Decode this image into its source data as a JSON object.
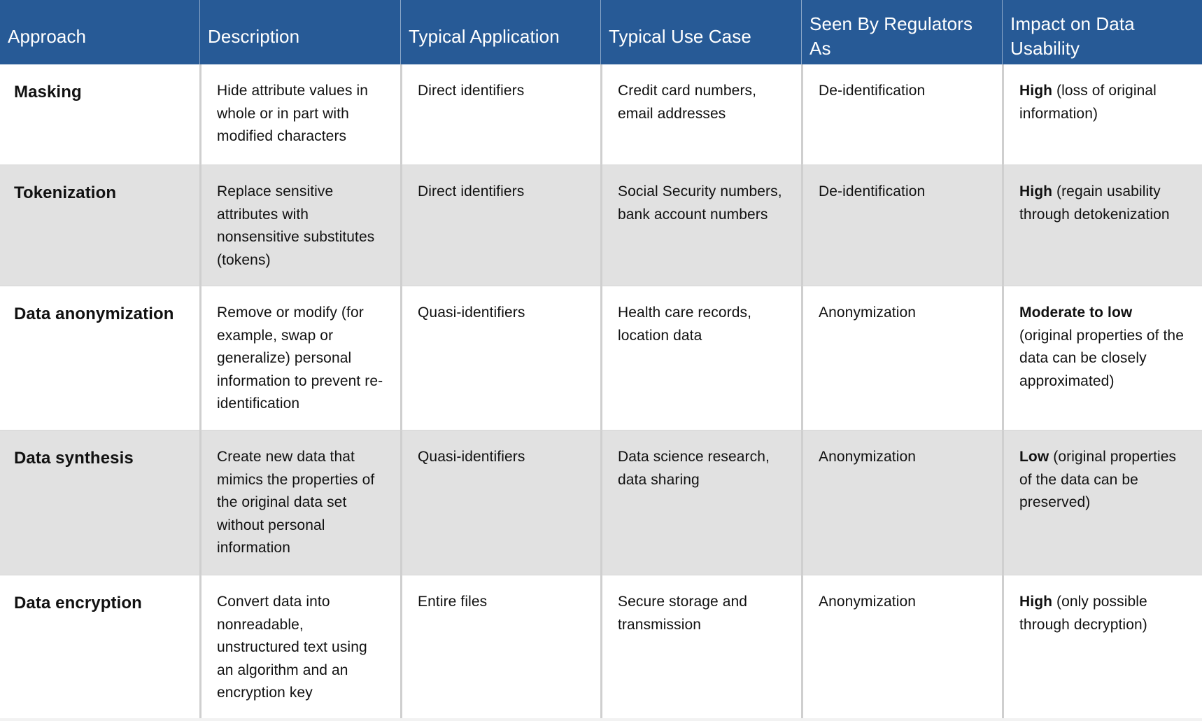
{
  "header": {
    "columns": [
      "Approach",
      "Description",
      "Typical Application",
      "Typical Use Case",
      "Seen By Regulators As",
      "Impact on Data Usability"
    ]
  },
  "rows": [
    {
      "approach": "Masking",
      "description": "Hide attribute values in whole or in part with modified characters",
      "typical_application": "Direct identifiers",
      "typical_use_case": "Credit card numbers, email addresses",
      "seen_by_regulators_as": "De-identification",
      "impact_level": "High",
      "impact_note": " (loss of original information)"
    },
    {
      "approach": "Tokenization",
      "description": "Replace sensitive attributes with nonsensitive substitutes (tokens)",
      "typical_application": "Direct identifiers",
      "typical_use_case": "Social Security numbers, bank account numbers",
      "seen_by_regulators_as": "De-identification",
      "impact_level": "High",
      "impact_note": " (regain usability through detokenization"
    },
    {
      "approach": "Data anonymization",
      "description": "Remove or modify (for example, swap or generalize) personal information to prevent re-identification",
      "typical_application": "Quasi-identifiers",
      "typical_use_case": "Health care records, location data",
      "seen_by_regulators_as": "Anonymization",
      "impact_level": "Moderate to low",
      "impact_note": " (original properties of the data can be closely approximated)"
    },
    {
      "approach": "Data synthesis",
      "description": "Create new data that mimics the properties of the original data set without personal information",
      "typical_application": "Quasi-identifiers",
      "typical_use_case": "Data science research, data sharing",
      "seen_by_regulators_as": "Anonymization",
      "impact_level": "Low",
      "impact_note": " (original properties of the data can be preserved)"
    },
    {
      "approach": "Data encryption",
      "description": "Convert data into nonreadable, unstructured text using an algorithm and an encryption key",
      "typical_application": "Entire files",
      "typical_use_case": "Secure storage and transmission",
      "seen_by_regulators_as": "Anonymization",
      "impact_level": "High",
      "impact_note": " (only possible through decryption)"
    }
  ]
}
